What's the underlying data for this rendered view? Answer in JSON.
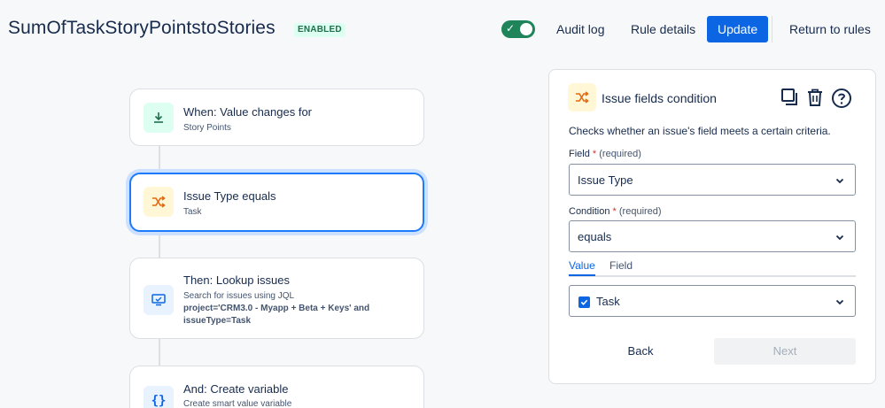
{
  "header": {
    "title": "SumOfTaskStoryPointstoStories",
    "status_badge": "ENABLED",
    "audit_log": "Audit log",
    "rule_details": "Rule details",
    "update": "Update",
    "return_to_rules": "Return to rules"
  },
  "flow": {
    "trigger": {
      "title": "When: Value changes for",
      "subtitle": "Story Points"
    },
    "condition": {
      "title": "Issue Type equals",
      "subtitle": "Task"
    },
    "lookup": {
      "title": "Then: Lookup issues",
      "subtitle": "Search for issues using JQL",
      "jql": "project='CRM3.0 - Myapp + Beta + Keys' and issueType=Task"
    },
    "variable": {
      "title": "And: Create variable",
      "subtitle": "Create smart value variable"
    }
  },
  "panel": {
    "title": "Issue fields condition",
    "description": "Checks whether an issue's field meets a certain criteria.",
    "field_label": "Field",
    "condition_label": "Condition",
    "required_marker": "*",
    "required_text": "(required)",
    "field_value": "Issue Type",
    "condition_value": "equals",
    "tab_value": "Value",
    "tab_field": "Field",
    "value_selected": "Task",
    "back": "Back",
    "next": "Next"
  },
  "colors": {
    "primary": "#0c66e4",
    "enabled_toggle": "#1f845a",
    "badge_bg": "#dcfff1",
    "badge_text": "#216e4e",
    "trigger_icon_bg": "#dcfff1",
    "condition_icon_bg": "#fff7d6",
    "action_icon_bg": "#e9f2ff"
  },
  "icons": {
    "trigger": "download-arrow-icon",
    "condition": "shuffle-branch-icon",
    "lookup": "monitor-search-icon",
    "variable": "curly-braces-icon",
    "copy": "copy-icon",
    "delete": "trash-icon",
    "help": "question-circle-icon"
  }
}
